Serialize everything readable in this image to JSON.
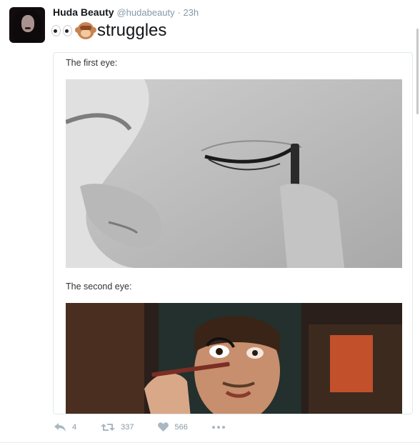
{
  "author": {
    "name": "Huda Beauty",
    "handle": "@hudabeauty",
    "time": "· 23h"
  },
  "tweet": {
    "text": "struggles",
    "emojis": [
      "eyes-emoji",
      "see-no-evil-monkey-emoji"
    ]
  },
  "media": {
    "caption_first": "The first eye:",
    "caption_second": "The second eye:"
  },
  "actions": {
    "reply_count": "4",
    "retweet_count": "337",
    "like_count": "566"
  },
  "colors": {
    "text": "#14171a",
    "muted": "#8899a6",
    "border": "#e1e8ed"
  }
}
